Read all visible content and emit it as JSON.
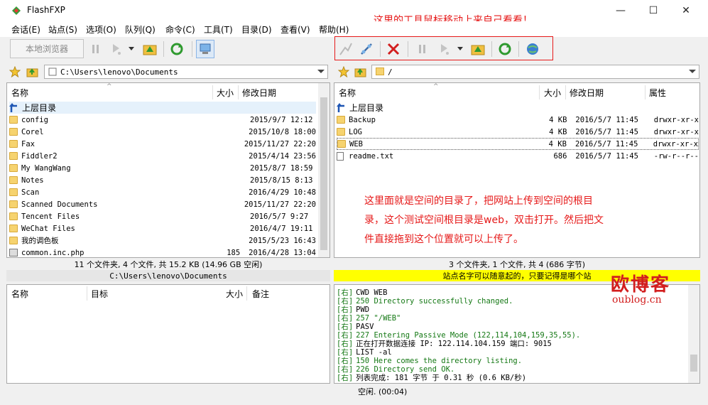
{
  "app": {
    "title": "FlashFXP"
  },
  "window": {
    "minimize": "—",
    "maximize": "☐",
    "close": "✕"
  },
  "menu": [
    "会话(E)",
    "站点(S)",
    "选项(O)",
    "队列(Q)",
    "命令(C)",
    "工具(T)",
    "目录(D)",
    "查看(V)",
    "帮助(H)"
  ],
  "toolbar": {
    "local_browser": "本地浏览器"
  },
  "annotation_top": "这里的工具鼠标移动上来自己看看！",
  "local": {
    "path": "C:\\Users\\lenovo\\Documents",
    "columns": {
      "name": "名称",
      "size": "大小",
      "date": "修改日期"
    },
    "parent": "上层目录",
    "files": [
      {
        "name": "config",
        "size": "",
        "date": "2015/9/7 12:12"
      },
      {
        "name": "Corel",
        "size": "",
        "date": "2015/10/8 18:00"
      },
      {
        "name": "Fax",
        "size": "",
        "date": "2015/11/27 22:20"
      },
      {
        "name": "Fiddler2",
        "size": "",
        "date": "2015/4/14 23:56"
      },
      {
        "name": "My WangWang",
        "size": "",
        "date": "2015/8/7 18:59"
      },
      {
        "name": "Notes",
        "size": "",
        "date": "2015/8/15 8:13"
      },
      {
        "name": "Scan",
        "size": "",
        "date": "2016/4/29 10:48"
      },
      {
        "name": "Scanned Documents",
        "size": "",
        "date": "2015/11/27 22:20"
      },
      {
        "name": "Tencent Files",
        "size": "",
        "date": "2016/5/7 9:27"
      },
      {
        "name": "WeChat Files",
        "size": "",
        "date": "2016/4/7 19:11"
      },
      {
        "name": "我的调色板",
        "size": "",
        "date": "2015/5/23 16:43"
      },
      {
        "name": "common.inc.php",
        "size": "185",
        "date": "2016/4/28 13:04"
      }
    ],
    "status": "11 个文件夹, 4 个文件, 共 15.2 KB (14.96 GB 空闲)",
    "status_path": "C:\\Users\\lenovo\\Documents"
  },
  "remote": {
    "path": "/",
    "columns": {
      "name": "名称",
      "size": "大小",
      "date": "修改日期",
      "attr": "属性"
    },
    "parent": "上层目录",
    "files": [
      {
        "name": "Backup",
        "size": "4 KB",
        "date": "2016/5/7 11:45",
        "attr": "drwxr-xr-x"
      },
      {
        "name": "LOG",
        "size": "4 KB",
        "date": "2016/5/7 11:45",
        "attr": "drwxr-xr-x"
      },
      {
        "name": "WEB",
        "size": "4 KB",
        "date": "2016/5/7 11:45",
        "attr": "drwxr-xr-x"
      },
      {
        "name": "readme.txt",
        "size": "686",
        "date": "2016/5/7 11:45",
        "attr": "-rw-r--r--"
      }
    ],
    "status": "3 个文件夹, 1 个文件, 共 4 (686 字节)",
    "site_note": "站点名字可以随意起的，只要记得是哪个站"
  },
  "annotation_main": [
    "这里面就是空间的目录了，把网站上传到空间的根目",
    "录，这个测试空间根目录是web，双击打开。然后把文",
    "件直接拖到这个位置就可以上传了。"
  ],
  "queue": {
    "columns": {
      "name": "名称",
      "target": "目标",
      "size": "大小",
      "note": "备注"
    }
  },
  "log": [
    {
      "tag": "[右]",
      "text": "CWD WEB",
      "green": false
    },
    {
      "tag": "[右]",
      "text": "250 Directory successfully changed.",
      "green": true
    },
    {
      "tag": "[右]",
      "text": "PWD",
      "green": false
    },
    {
      "tag": "[右]",
      "text": "257 \"/WEB\"",
      "green": true
    },
    {
      "tag": "[右]",
      "text": "PASV",
      "green": false
    },
    {
      "tag": "[右]",
      "text": "227 Entering Passive Mode (122,114,104,159,35,55).",
      "green": true
    },
    {
      "tag": "[右]",
      "text": "正在打开数据连接 IP: 122.114.104.159 端口: 9015",
      "green": false
    },
    {
      "tag": "[右]",
      "text": "LIST -al",
      "green": false
    },
    {
      "tag": "[右]",
      "text": "150 Here comes the directory listing.",
      "green": true
    },
    {
      "tag": "[右]",
      "text": "226 Directory send OK.",
      "green": true
    },
    {
      "tag": "[右]",
      "text": "列表完成: 181 字节 于 0.31 秒 (0.6 KB/秒)",
      "green": false
    }
  ],
  "bottom_status": "空闲. (00:04)",
  "watermark": {
    "cn": "欧博客",
    "url": "oublog.cn"
  },
  "colors": {
    "accent_red": "#e61919",
    "log_green": "#147814",
    "site_bar": "#ffff00"
  }
}
